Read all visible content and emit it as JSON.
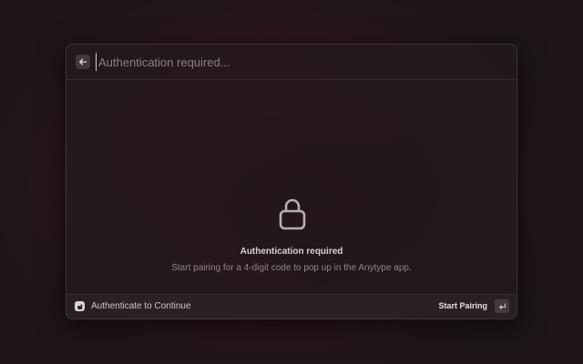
{
  "header": {
    "back_icon": "arrow-left-icon",
    "search_placeholder": "Authentication required..."
  },
  "empty_state": {
    "icon": "lock-icon",
    "title": "Authentication required",
    "subtitle": "Start pairing for a 4-digit code to pop up in the Anytype app."
  },
  "footer": {
    "app_icon": "anytype-icon",
    "label": "Authenticate to Continue",
    "primary_action": "Start Pairing",
    "shortcut_icon": "return-key-icon"
  },
  "colors": {
    "background": "#2a171d",
    "accent_glow": "#4a1c2a",
    "window": "#241a1e"
  }
}
